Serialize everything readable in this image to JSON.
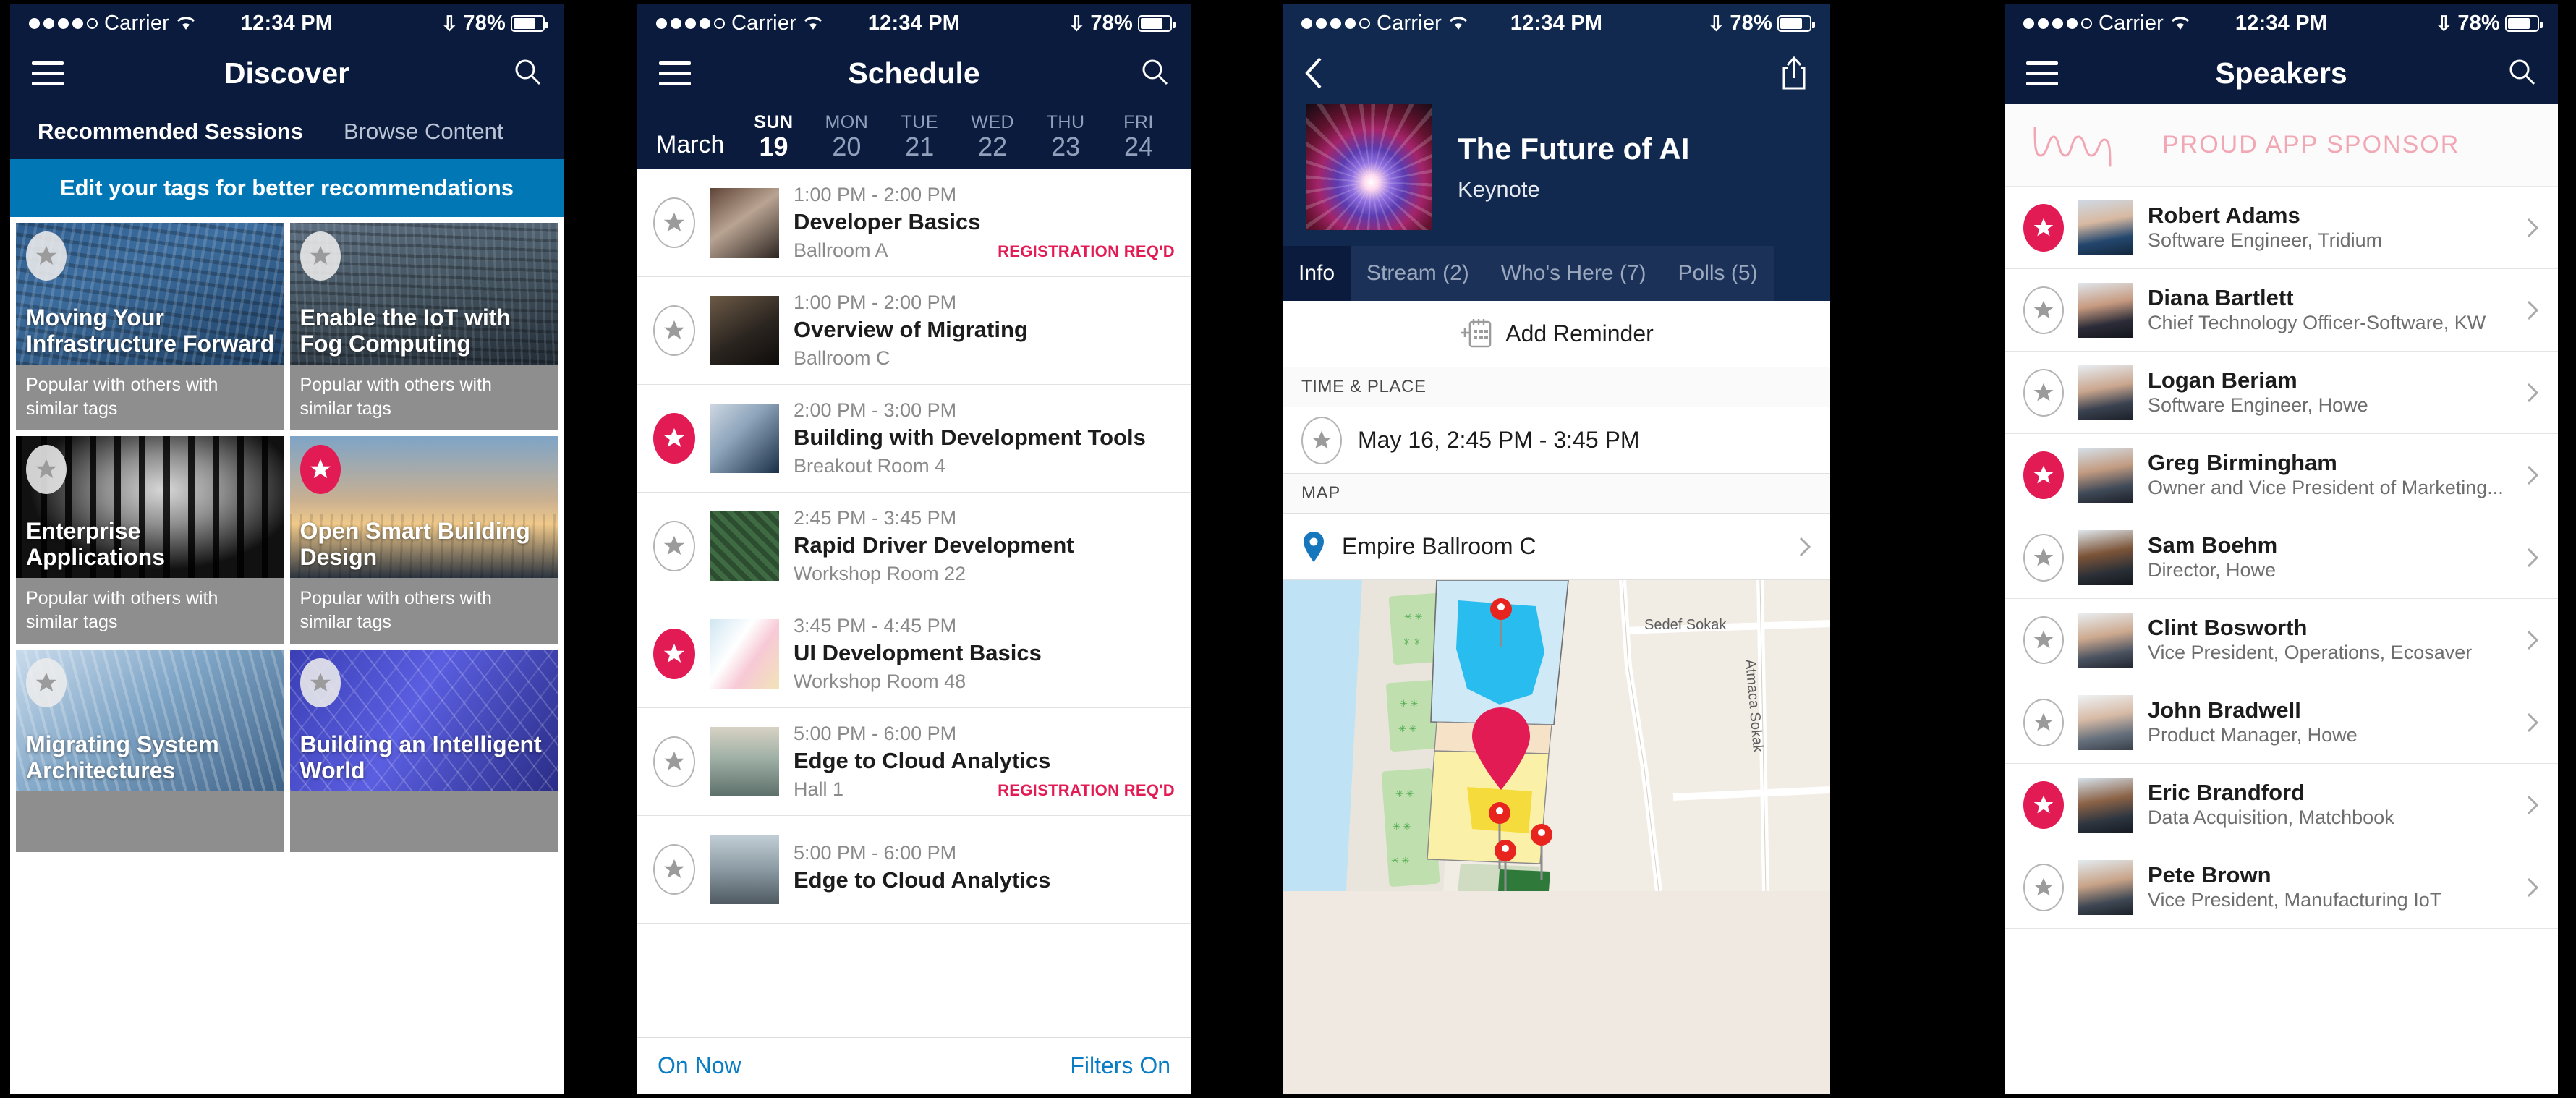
{
  "status_bar": {
    "carrier": "Carrier",
    "time": "12:34 PM",
    "battery": "78%",
    "signal_dots": 5,
    "signal_filled": 4
  },
  "panel1": {
    "nav": {
      "title": "Discover",
      "menu_icon": "hamburger-icon",
      "search_icon": "search-icon"
    },
    "tabs": [
      {
        "label": "Recommended Sessions",
        "active": true
      },
      {
        "label": "Browse Content",
        "active": false
      }
    ],
    "edit_banner": "Edit your tags for better recommendations",
    "tiles": [
      {
        "title": "Moving Your Infrastructure Forward",
        "subtitle": "Popular with others with similar tags",
        "starred": false,
        "image": "office-towers-blue"
      },
      {
        "title": "Enable the IoT with Fog Computing",
        "subtitle": "Popular with others with similar tags",
        "starred": false,
        "image": "skyscrapers-grey"
      },
      {
        "title": "Enterprise Applications",
        "subtitle": "Popular with others with similar tags",
        "starred": false,
        "image": "people-silhouette-window"
      },
      {
        "title": "Open Smart Building Design",
        "subtitle": "Popular with others with similar tags",
        "starred": true,
        "image": "city-skyline-sunset"
      },
      {
        "title": "Migrating System Architectures",
        "subtitle": "",
        "starred": false,
        "image": "glass-facade-blue"
      },
      {
        "title": "Building an Intelligent World",
        "subtitle": "",
        "starred": false,
        "image": "blue-structure-gradient"
      }
    ]
  },
  "panel2": {
    "nav": {
      "title": "Schedule",
      "menu_icon": "hamburger-icon",
      "search_icon": "search-icon"
    },
    "month": "March",
    "days": [
      {
        "dow": "SUN",
        "num": "19",
        "active": true
      },
      {
        "dow": "MON",
        "num": "20",
        "active": false
      },
      {
        "dow": "TUE",
        "num": "21",
        "active": false
      },
      {
        "dow": "WED",
        "num": "22",
        "active": false
      },
      {
        "dow": "THU",
        "num": "23",
        "active": false
      },
      {
        "dow": "FRI",
        "num": "24",
        "active": false
      }
    ],
    "sessions": [
      {
        "time": "1:00 PM - 2:00 PM",
        "title": "Developer Basics",
        "room": "Ballroom A",
        "reg": "REGISTRATION REQ'D",
        "starred": false,
        "image": "laptop-cafe"
      },
      {
        "time": "1:00 PM - 2:00 PM",
        "title": "Overview of Migrating",
        "room": "Ballroom C",
        "reg": "",
        "starred": false,
        "image": "laptop-desk-dark"
      },
      {
        "time": "2:00 PM - 3:00 PM",
        "title": "Building with Development Tools",
        "room": "Breakout Room 4",
        "reg": "",
        "starred": true,
        "image": "woman-at-monitor"
      },
      {
        "time": "2:45 PM - 3:45 PM",
        "title": "Rapid Driver Development",
        "room": "Workshop Room 22",
        "reg": "",
        "starred": false,
        "image": "circuit-boards"
      },
      {
        "time": "3:45 PM - 4:45 PM",
        "title": "UI Development Basics",
        "room": "Workshop Room 48",
        "reg": "",
        "starred": true,
        "image": "paper-shapes-pastel"
      },
      {
        "time": "5:00 PM - 6:00 PM",
        "title": "Edge to Cloud Analytics",
        "room": "Hall 1",
        "reg": "REGISTRATION REQ'D",
        "starred": false,
        "image": "mountain-lake"
      },
      {
        "time": "5:00 PM - 6:00 PM",
        "title": "Edge to Cloud Analytics",
        "room": "",
        "reg": "",
        "starred": false,
        "image": "shoreline"
      }
    ],
    "bottom_bar": {
      "left": "On Now",
      "right": "Filters On"
    }
  },
  "panel3": {
    "nav": {
      "back_icon": "chevron-left-icon",
      "share_icon": "share-icon"
    },
    "hero": {
      "title": "The Future of AI",
      "subtitle": "Keynote",
      "image": "plasma-ball"
    },
    "tabs": [
      {
        "label": "Info",
        "active": true
      },
      {
        "label": "Stream (2)",
        "active": false
      },
      {
        "label": "Who's Here (7)",
        "active": false
      },
      {
        "label": "Polls (5)",
        "active": false
      }
    ],
    "add_reminder": "Add Reminder",
    "sections": [
      {
        "header": "TIME & PLACE",
        "row_text": "May 16, 2:45 PM - 3:45 PM",
        "icon": "star-icon"
      },
      {
        "header": "MAP",
        "row_text": "Empire Ballroom C",
        "icon": "map-pin-icon"
      }
    ],
    "map_labels": [
      "Sedef Sokak",
      "Atmaca Sokak"
    ]
  },
  "panel4": {
    "nav": {
      "title": "Speakers",
      "menu_icon": "hamburger-icon",
      "search_icon": "search-icon"
    },
    "sponsor": {
      "text": "PROUD APP SPONSOR",
      "logo": "bunday-script-logo"
    },
    "speakers": [
      {
        "name": "Robert Adams",
        "role": "Software Engineer, Tridium",
        "starred": true
      },
      {
        "name": "Diana Bartlett",
        "role": "Chief Technology Officer-Software, KW",
        "starred": false
      },
      {
        "name": "Logan Beriam",
        "role": "Software Engineer, Howe",
        "starred": false
      },
      {
        "name": "Greg Birmingham",
        "role": "Owner and Vice President of Marketing...",
        "starred": true
      },
      {
        "name": "Sam Boehm",
        "role": "Director, Howe",
        "starred": false
      },
      {
        "name": "Clint Bosworth",
        "role": "Vice President, Operations, Ecosaver",
        "starred": false
      },
      {
        "name": "John Bradwell",
        "role": "Product Manager, Howe",
        "starred": false
      },
      {
        "name": "Eric Brandford",
        "role": "Data Acquisition, Matchbook",
        "starred": true
      },
      {
        "name": "Pete Brown",
        "role": "Vice President, Manufacturing IoT",
        "starred": false
      }
    ]
  },
  "colors": {
    "navy": "#0a1b3d",
    "hero_navy": "#12294f",
    "banner_blue": "#0277b6",
    "link_blue": "#0a7cc4",
    "accent_pink": "#e31b54",
    "sponsor_pink": "#f2a7b4",
    "subtitle_grey": "#8e8e8e"
  }
}
